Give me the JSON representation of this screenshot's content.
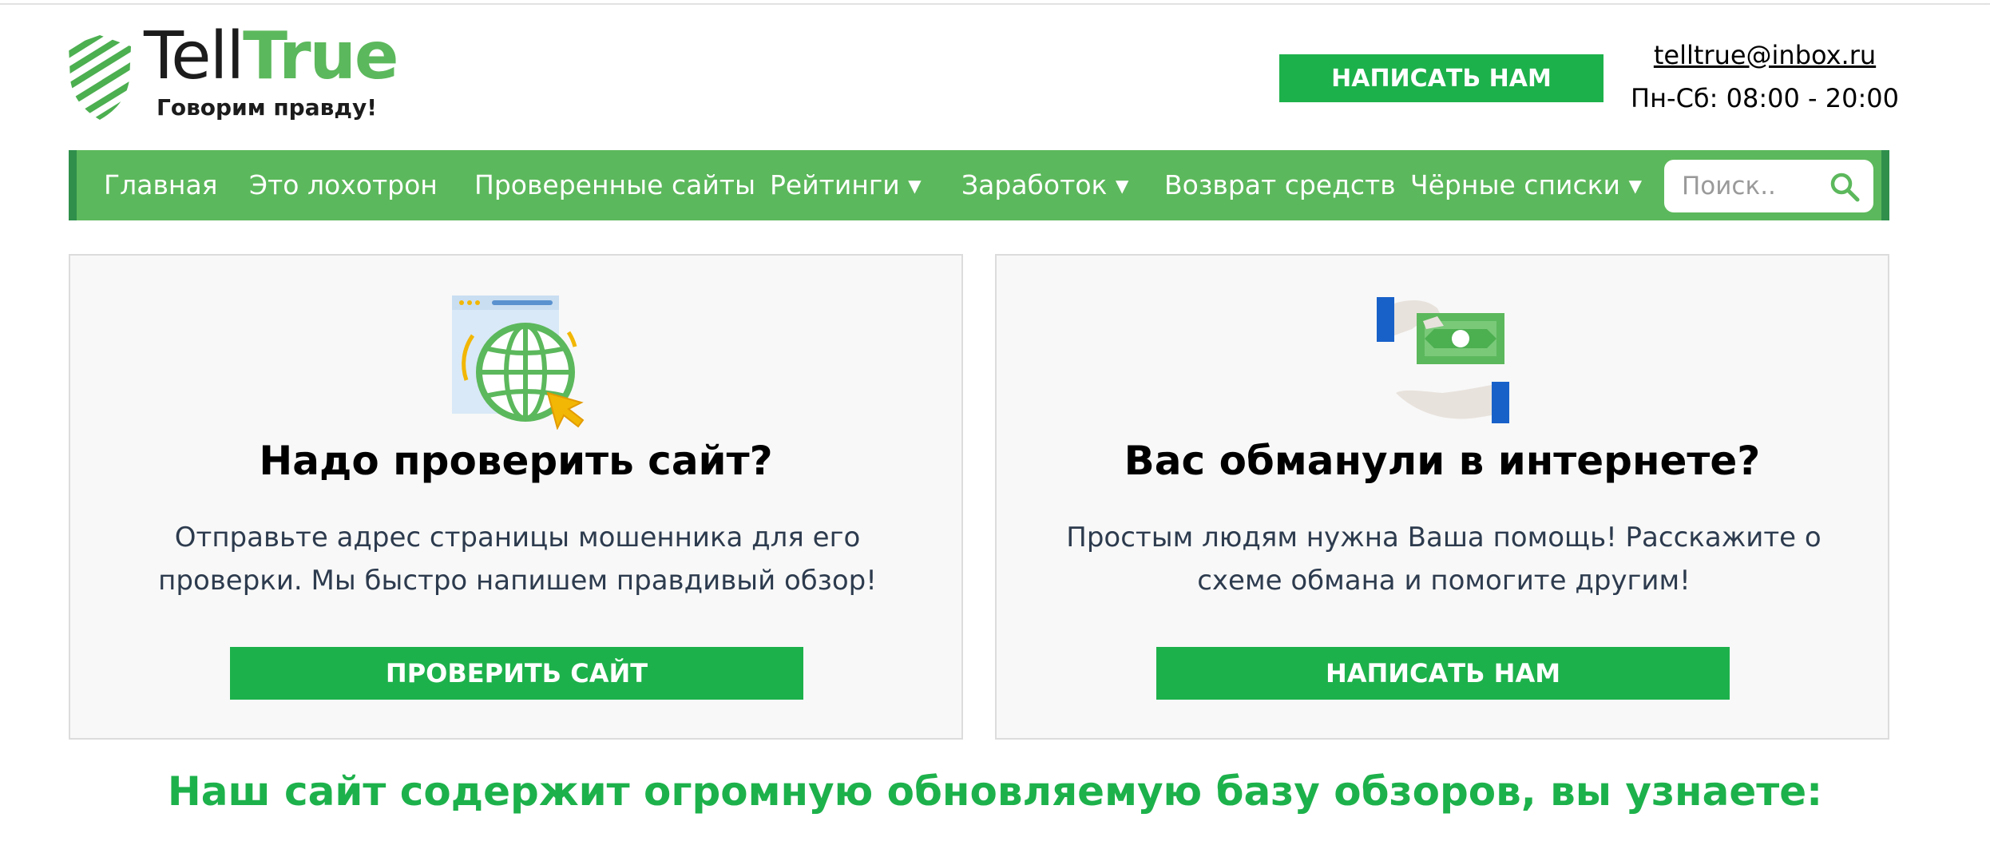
{
  "logo": {
    "word1": "Tell",
    "word2": "True",
    "slogan": "Говорим правду!"
  },
  "header": {
    "write_button": "НАПИСАТЬ НАМ",
    "email": "telltrue@inbox.ru",
    "hours": "Пн-Сб: 08:00 - 20:00"
  },
  "nav": {
    "items": [
      {
        "label": "Главная"
      },
      {
        "label": "Это лохотрон"
      },
      {
        "label": "Проверенные сайты"
      },
      {
        "label": "Рейтинги ▾"
      },
      {
        "label": "Заработок ▾"
      },
      {
        "label": "Возврат средств"
      },
      {
        "label": "Чёрные списки ▾"
      }
    ],
    "search_placeholder": "Поиск.."
  },
  "cards": [
    {
      "icon": "globe-browser-icon",
      "title": "Надо проверить сайт?",
      "text": "Отправьте адрес страницы мошенника для его проверки. Мы быстро напишем правдивый обзор!",
      "button": "ПРОВЕРИТЬ САЙТ"
    },
    {
      "icon": "money-hands-icon",
      "title": "Вас обманули в интернете?",
      "text": "Простым людям нужна Ваша помощь! Расскажите о схеме обмана и помогите другим!",
      "button": "НАПИСАТЬ НАМ"
    }
  ],
  "bottom_heading": "Наш сайт содержит огромную обновляемую базу обзоров, вы узнаете:",
  "colors": {
    "brand_green": "#1db14b",
    "nav_green": "#5cb85c",
    "nav_border": "#2f8f4b"
  }
}
